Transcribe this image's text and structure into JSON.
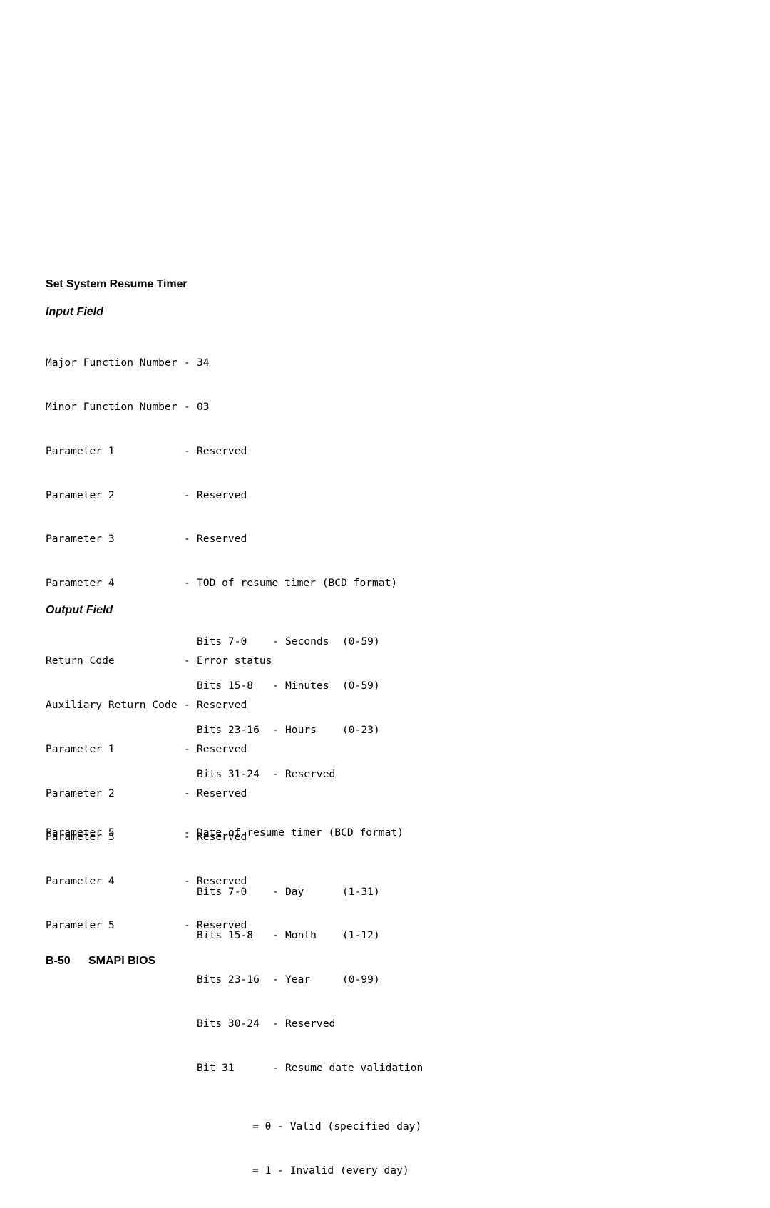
{
  "document": {
    "section_title": "Set System Resume Timer",
    "input_field": {
      "heading": "Input Field",
      "rows": [
        {
          "label": "Major Function Number",
          "dash": "-",
          "value": "34"
        },
        {
          "label": "Minor Function Number",
          "dash": "-",
          "value": "03"
        },
        {
          "label": "Parameter 1",
          "dash": "-",
          "value": "Reserved"
        },
        {
          "label": "Parameter 2",
          "dash": "-",
          "value": "Reserved"
        },
        {
          "label": "Parameter 3",
          "dash": "-",
          "value": "Reserved"
        },
        {
          "label": "Parameter 4",
          "dash": "-",
          "value": "TOD of resume timer (BCD format)"
        },
        {
          "label": "Parameter 5",
          "dash": "-",
          "value": "Date of resume timer (BCD format)"
        }
      ],
      "param4_bits": [
        {
          "bits": "Bits 7-0",
          "dash": "-",
          "name": "Seconds",
          "range": "(0-59)"
        },
        {
          "bits": "Bits 15-8",
          "dash": "-",
          "name": "Minutes",
          "range": "(0-59)"
        },
        {
          "bits": "Bits 23-16",
          "dash": "-",
          "name": "Hours",
          "range": "(0-23)"
        },
        {
          "bits": "Bits 31-24",
          "dash": "-",
          "name": "Reserved",
          "range": ""
        }
      ],
      "param5_bits": [
        {
          "bits": "Bits 7-0",
          "dash": "-",
          "name": "Day",
          "range": "(1-31)"
        },
        {
          "bits": "Bits 15-8",
          "dash": "-",
          "name": "Month",
          "range": "(1-12)"
        },
        {
          "bits": "Bits 23-16",
          "dash": "-",
          "name": "Year",
          "range": "(0-99)"
        },
        {
          "bits": "Bits 30-24",
          "dash": "-",
          "name": "Reserved",
          "range": ""
        },
        {
          "bits": "Bit 31",
          "dash": "-",
          "name": "Resume date validation",
          "range": ""
        }
      ],
      "bit31_values": [
        "= 0 - Valid (specified day)",
        "= 1 - Invalid (every day)"
      ]
    },
    "output_field": {
      "heading": "Output Field",
      "rows": [
        {
          "label": "Return Code",
          "dash": "-",
          "value": "Error status"
        },
        {
          "label": "Auxiliary Return Code",
          "dash": "-",
          "value": "Reserved"
        },
        {
          "label": "Parameter 1",
          "dash": "-",
          "value": "Reserved"
        },
        {
          "label": "Parameter 2",
          "dash": "-",
          "value": "Reserved"
        },
        {
          "label": "Parameter 3",
          "dash": "-",
          "value": "Reserved"
        },
        {
          "label": "Parameter 4",
          "dash": "-",
          "value": "Reserved"
        },
        {
          "label": "Parameter 5",
          "dash": "-",
          "value": "Reserved"
        }
      ]
    },
    "footer": {
      "page_number": "B-50",
      "title": "SMAPI BIOS"
    }
  }
}
